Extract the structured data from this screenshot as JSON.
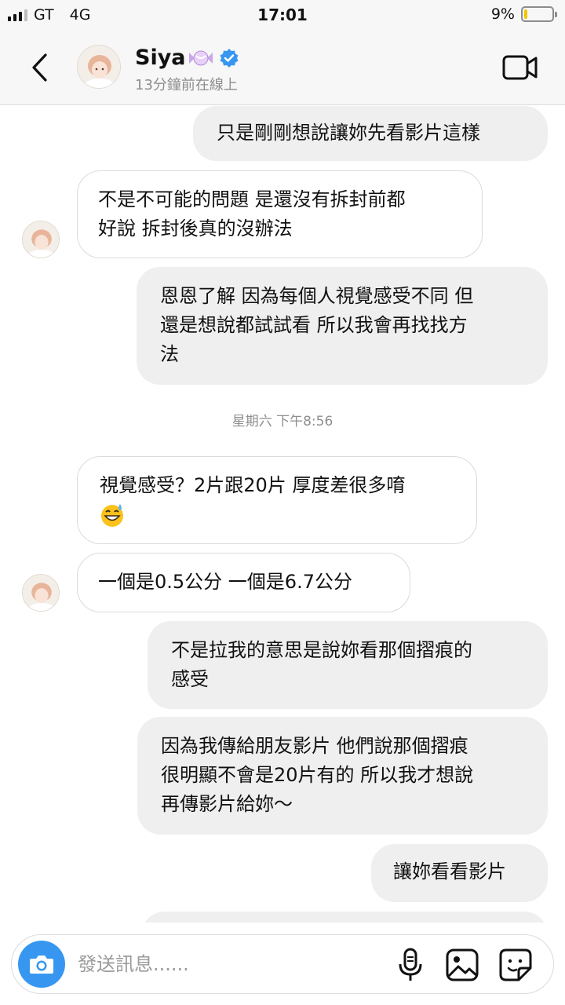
{
  "status_bar": {
    "carrier": "GT",
    "network": "4G",
    "time": "17:01",
    "battery": "9%",
    "battery_level": 0.09
  },
  "header": {
    "name": "Siya",
    "status": "13分鐘前在線上",
    "verified": true,
    "name_emoji": "candy-emoji"
  },
  "messages": [
    {
      "side": "out",
      "text": "只是剛剛想說讓妳先看影片這樣"
    },
    {
      "side": "in",
      "lines": [
        "不是不可能的問題 是還沒有拆封前都",
        "好說 拆封後真的沒辦法"
      ]
    },
    {
      "side": "out",
      "lines": [
        "恩恩了解 因為每個人視覺感受不同 但",
        "還是想說都試試看 所以我會再找找方",
        "法"
      ]
    },
    {
      "type": "timestamp",
      "text": "星期六 下午8:56"
    },
    {
      "side": "in",
      "lines": [
        "視覺感受？2片跟20片 厚度差很多唷"
      ],
      "emoji": "grinning-sweat-emoji"
    },
    {
      "side": "in",
      "text": "一個是0.5公分 一個是6.7公分"
    },
    {
      "side": "out",
      "lines": [
        "不是拉我的意思是說妳看那個摺痕的",
        "感受"
      ]
    },
    {
      "side": "out",
      "lines": [
        "因為我傳給朋友影片 他們說那個摺痕",
        "很明顯不會是20片有的 所以我才想說",
        "再傳影片給妳～"
      ]
    },
    {
      "side": "out",
      "text": "讓妳看看影片"
    }
  ],
  "composer": {
    "placeholder": "發送訊息......"
  },
  "colors": {
    "accent": "#3797f0",
    "outgoing_bubble": "#efefef",
    "incoming_border": "#dbdbdb",
    "muted_text": "#8e8e8e",
    "battery": "#f2c500"
  }
}
